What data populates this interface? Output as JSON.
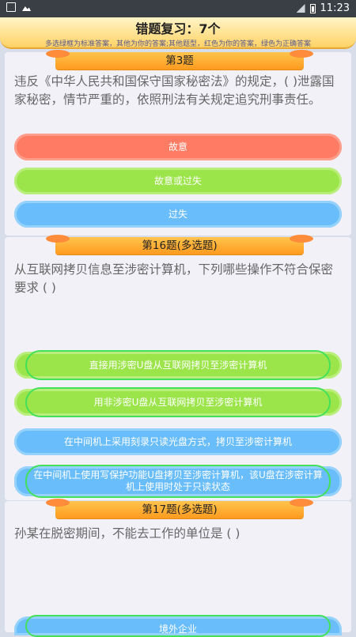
{
  "status_bar": {
    "time": "11:23"
  },
  "header": {
    "title": "错题复习：7个",
    "subtitle": "多选绿框为标准答案，其他为你的答案;其他题型，红色为你的答案，绿色为正确答案"
  },
  "questions": [
    {
      "label": "第3题",
      "text": "违反《中华人民共和国保守国家秘密法》的规定，( )泄露国家秘密，情节严重的，依照刑法有关规定追究刑事责任。",
      "options": [
        {
          "text": "故意",
          "color": "red"
        },
        {
          "text": "故意或过失",
          "color": "green"
        },
        {
          "text": "过失",
          "color": "blue"
        }
      ]
    },
    {
      "label": "第16题(多选题)",
      "text": "从互联网拷贝信息至涉密计算机，下列哪些操作不符合保密要求 ( )",
      "options": [
        {
          "text": "直接用涉密U盘从互联网拷贝至涉密计算机",
          "color": "green"
        },
        {
          "text": "用非涉密U盘从互联网拷贝至涉密计算机",
          "color": "green"
        },
        {
          "text": "在中间机上采用刻录只读光盘方式，拷贝至涉密计算机",
          "color": "blue"
        },
        {
          "text": "在中间机上使用写保护功能U盘拷贝至涉密计算机，该U盘在涉密计算机上使用时处于只读状态",
          "color": "blue"
        }
      ]
    },
    {
      "label": "第17题(多选题)",
      "text": "孙某在脱密期间，不能去工作的单位是 ( )",
      "options": [
        {
          "text": "境外企业",
          "color": "blue"
        }
      ]
    }
  ],
  "colors": {
    "wrong": "#ff7b63",
    "correct": "#9be449",
    "neutral": "#69bdfb",
    "standard_frame": "#43e05a"
  }
}
